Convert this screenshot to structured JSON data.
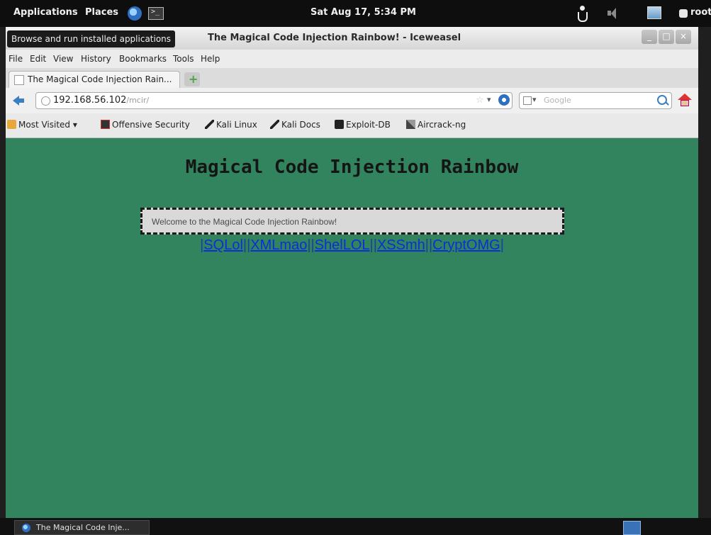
{
  "top_panel": {
    "applications": "Applications",
    "places": "Places",
    "clock": "Sat Aug 17,  5:34 PM",
    "user": "root"
  },
  "window": {
    "tooltip": "Browse and run installed applications",
    "title": "The Magical Code Injection Rainbow! - Iceweasel"
  },
  "menu": [
    "File",
    "Edit",
    "View",
    "History",
    "Bookmarks",
    "Tools",
    "Help"
  ],
  "tab": {
    "title": "The Magical Code Injection Rain..."
  },
  "navbar": {
    "url_host": "192.168.56.102",
    "url_path": "/mcir/",
    "search_placeholder": "Google"
  },
  "bookmarks": [
    "Most Visited",
    "Offensive Security",
    "Kali Linux",
    "Kali Docs",
    "Exploit-DB",
    "Aircrack-ng"
  ],
  "page": {
    "heading": "Magical Code Injection Rainbow",
    "welcome": "Welcome to the Magical Code Injection Rainbow!",
    "links": [
      "SQLol",
      "XMLmao",
      "ShelLOL",
      "XSSmh",
      "CryptOMG"
    ]
  },
  "taskbar": {
    "window_label": "The Magical Code Inje..."
  },
  "colors": {
    "page_background": "#32845f",
    "link": "#0b2fd6"
  }
}
